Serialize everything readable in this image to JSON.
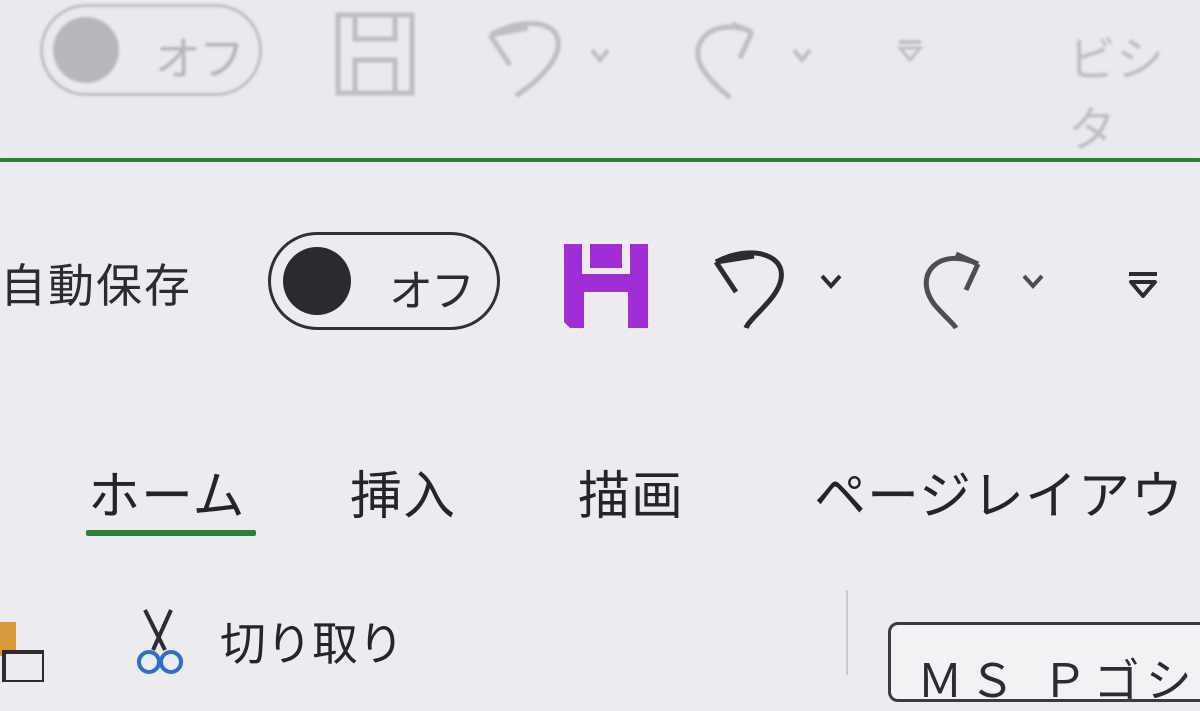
{
  "ghost_bar": {
    "toggle_label": "オフ",
    "partial_word": "ビシタ"
  },
  "qat": {
    "autosave_label": "自動保存",
    "toggle_label": "オフ",
    "save_color": "#9a2fd0"
  },
  "tabs": [
    {
      "label": "ホーム",
      "active": true
    },
    {
      "label": "挿入"
    },
    {
      "label": "描画"
    },
    {
      "label": "ページレイアウ"
    }
  ],
  "ribbon": {
    "cut_label": "切り取り",
    "font_name": "ＭＳ Ｐゴシ"
  },
  "colors": {
    "accent_green": "#2f7d3a",
    "save_purple": "#9a2fd0"
  },
  "icons": [
    "save-icon",
    "undo-icon",
    "redo-icon",
    "chevron-down-icon",
    "customize-qat-icon",
    "scissors-icon",
    "paste-icon"
  ]
}
